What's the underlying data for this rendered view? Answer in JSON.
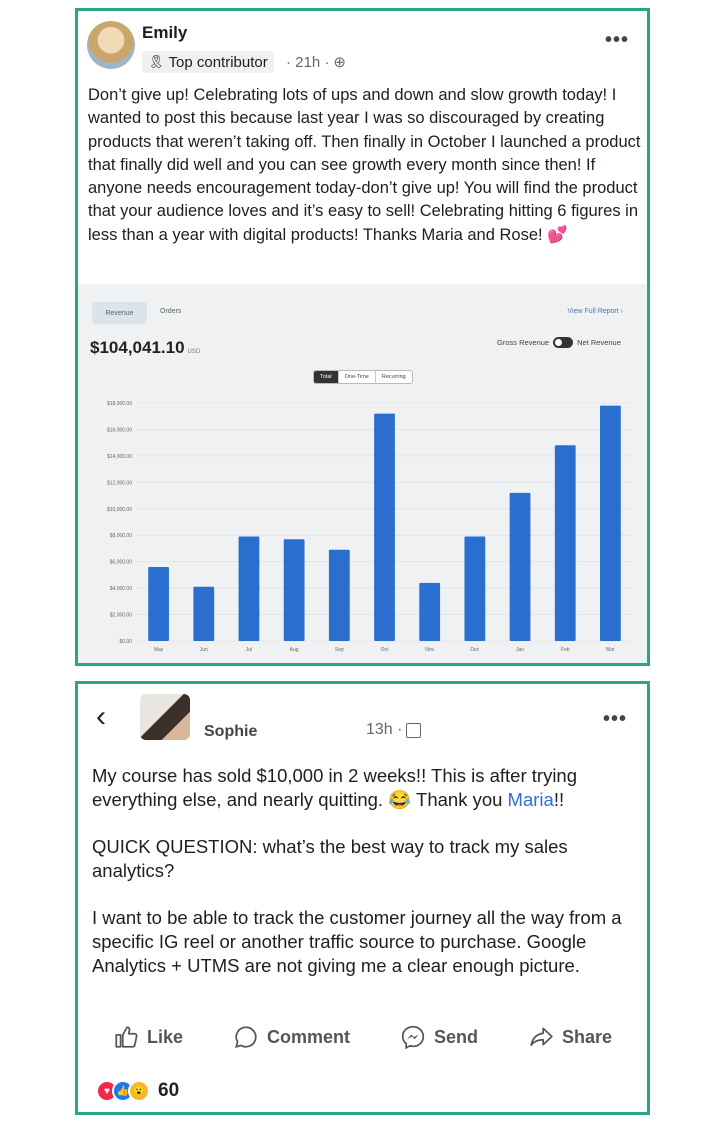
{
  "post1": {
    "author": "Emily",
    "badge": "Top contributor",
    "time": "· 21h ·",
    "privacy_icon": "globe-icon",
    "more": "•••",
    "text": "Don’t give up! Celebrating lots of ups and down and slow growth today! I wanted to post this because last year I was so discouraged by creating products that weren’t taking off. Then finally in October I launched a product that finally did well and you can see growth every month since then! If anyone needs encouragement today-don’t give up! You will find the product that your audience loves and it’s easy to sell! Celebrating hitting 6 figures in less than a year with digital products! Thanks Maria and Rose! 💕"
  },
  "screenshot": {
    "tabs": [
      "Revenue",
      "Orders"
    ],
    "view_full_report": "View Full Report ›",
    "total": "$104,041.10",
    "currency": "USD",
    "toggle_left": "Gross Revenue",
    "toggle_right": "Net Revenue",
    "segments": [
      "Total",
      "One-Time",
      "Recurring"
    ]
  },
  "chart_data": {
    "type": "bar",
    "categories": [
      "May",
      "Jun",
      "Jul",
      "Aug",
      "Sep",
      "Oct",
      "Nov",
      "Dec",
      "Jan",
      "Feb",
      "Mar"
    ],
    "values": [
      5600,
      4100,
      7900,
      7700,
      6900,
      17200,
      4400,
      7900,
      11200,
      14800,
      17800
    ],
    "ylim": [
      0,
      18000
    ],
    "yticks": [
      "$0.00",
      "$2,000.00",
      "$4,000.00",
      "$6,000.00",
      "$8,000.00",
      "$10,000.00",
      "$12,000.00",
      "$14,000.00",
      "$16,000.00",
      "$18,000.00"
    ],
    "bar_color": "#2a6fd0",
    "grid": true
  },
  "post2": {
    "back": "‹",
    "author": "Sophie",
    "time": "13h ·",
    "more": "•••",
    "p1_a": "My course has sold $10,000 in 2 weeks!! This is after trying everything else, and nearly quitting. 😂 Thank you ",
    "p1_link": "Maria",
    "p1_b": "!!",
    "p2": "QUICK QUESTION: what’s the best way to track my sales analytics?",
    "p3": "I want to be able to track the customer journey all the way from a specific IG reel or another traffic source to purchase. Google Analytics + UTMS are not giving me a clear enough picture.",
    "actions": {
      "like": "Like",
      "comment": "Comment",
      "send": "Send",
      "share": "Share"
    },
    "reaction_count": "60"
  },
  "colors": {
    "frame": "#2aa587",
    "link": "#2f6fd4",
    "bar": "#2a6fd0"
  }
}
